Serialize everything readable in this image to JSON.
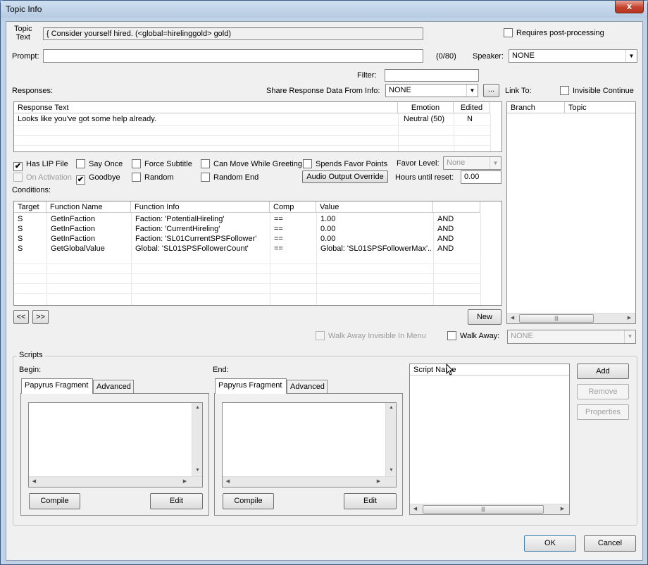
{
  "window": {
    "title": "Topic Info",
    "close_glyph": "x"
  },
  "topic": {
    "label_line1": "Topic",
    "label_line2": "Text",
    "value": "{ Consider yourself hired. (<global=hirelinggold> gold)"
  },
  "requires_post": {
    "label": "Requires post-processing",
    "checked": false
  },
  "prompt": {
    "label": "Prompt:",
    "value": "",
    "counter": "(0/80)"
  },
  "speaker": {
    "label": "Speaker:",
    "value": "NONE"
  },
  "filter": {
    "label": "Filter:",
    "value": ""
  },
  "responses": {
    "label": "Responses:",
    "share_label": "Share Response Data From Info:",
    "share_value": "NONE",
    "ellipsis": "...",
    "columns": [
      "Response Text",
      "Emotion",
      "Edited"
    ],
    "rows": [
      [
        "Looks like you've got some help already.",
        "Neutral (50)",
        "N"
      ]
    ]
  },
  "link_to": {
    "label": "Link To:",
    "invisible_continue": "Invisible Continue",
    "columns": [
      "Branch",
      "Topic"
    ]
  },
  "options": {
    "has_lip": "Has LIP File",
    "say_once": "Say Once",
    "force_subtitle": "Force Subtitle",
    "can_move": "Can Move While Greeting",
    "spends_favor": "Spends Favor Points",
    "favor_level_label": "Favor Level:",
    "favor_level_value": "None",
    "on_activation": "On Activation",
    "goodbye": "Goodbye",
    "random": "Random",
    "random_end": "Random End",
    "audio_override": "Audio Output Override",
    "hours_label": "Hours until reset:",
    "hours_value": "0.00"
  },
  "conditions": {
    "label": "Conditions:",
    "columns": [
      "Target",
      "Function Name",
      "Function Info",
      "Comp",
      "Value",
      ""
    ],
    "rows": [
      [
        "S",
        "GetInFaction",
        "Faction: 'PotentialHireling'",
        "==",
        "1.00",
        "AND"
      ],
      [
        "S",
        "GetInFaction",
        "Faction: 'CurrentHireling'",
        "==",
        "0.00",
        "AND"
      ],
      [
        "S",
        "GetInFaction",
        "Faction: 'SL01CurrentSPSFollower'",
        "==",
        "0.00",
        "AND"
      ],
      [
        "S",
        "GetGlobalValue",
        "Global: 'SL01SPSFollowerCount'",
        "==",
        "Global: 'SL01SPSFollowerMax'...",
        "AND"
      ]
    ],
    "prev": "<<",
    "next": ">>",
    "new": "New"
  },
  "walk_away": {
    "invisible_label": "Walk Away Invisible In Menu",
    "label": "Walk Away:",
    "value": "NONE"
  },
  "scripts": {
    "group_label": "Scripts",
    "begin_label": "Begin:",
    "end_label": "End:",
    "tab_fragment": "Papyrus Fragment",
    "tab_advanced": "Advanced",
    "compile": "Compile",
    "edit": "Edit",
    "list_header": "Script Name",
    "add": "Add",
    "remove": "Remove",
    "properties": "Properties"
  },
  "footer": {
    "ok": "OK",
    "cancel": "Cancel"
  }
}
